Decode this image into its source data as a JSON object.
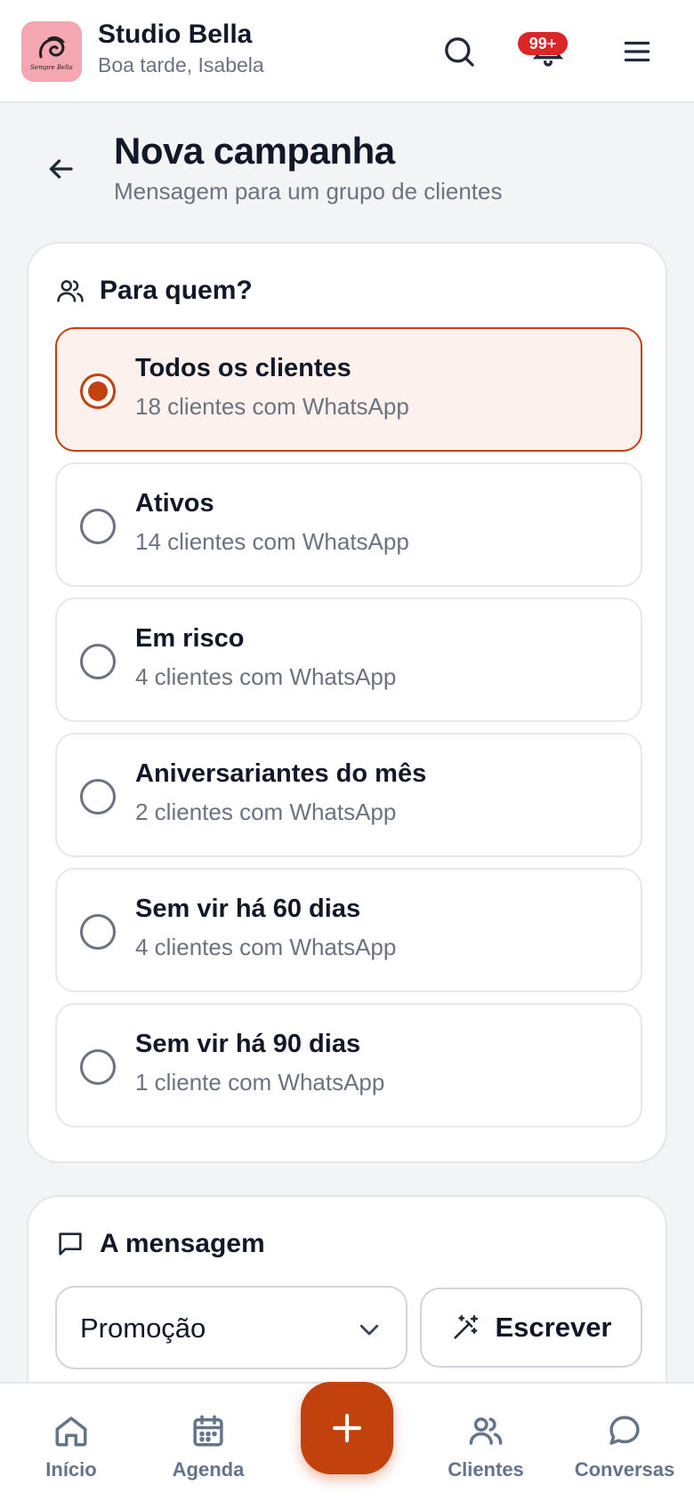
{
  "colors": {
    "accent": "#c2410c",
    "selected_bg": "#fcf1ed",
    "badge": "#dc2626",
    "muted_text": "#6b7280",
    "logo_bg": "#f4a7b0"
  },
  "header": {
    "brand_name": "Studio Bella",
    "greeting": "Boa tarde, Isabela",
    "logo_text": "Sempre Bella",
    "notification_badge": "99+",
    "icons": [
      "search-icon",
      "notifications-icon",
      "menu-icon"
    ]
  },
  "page": {
    "title": "Nova campanha",
    "subtitle": "Mensagem para um grupo de clientes"
  },
  "audience": {
    "title": "Para quem?",
    "options": [
      {
        "label": "Todos os clientes",
        "count": "18 clientes com WhatsApp",
        "selected": true
      },
      {
        "label": "Ativos",
        "count": "14 clientes com WhatsApp",
        "selected": false
      },
      {
        "label": "Em risco",
        "count": "4 clientes com WhatsApp",
        "selected": false
      },
      {
        "label": "Aniversariantes do mês",
        "count": "2 clientes com WhatsApp",
        "selected": false
      },
      {
        "label": "Sem vir há 60 dias",
        "count": "4 clientes com WhatsApp",
        "selected": false
      },
      {
        "label": "Sem vir há 90 dias",
        "count": "1 cliente com WhatsApp",
        "selected": false
      }
    ]
  },
  "message": {
    "title": "A mensagem",
    "type_select_value": "Promoção",
    "write_button": "Escrever"
  },
  "bottom_nav": {
    "items": [
      {
        "label": "Início",
        "icon": "home-icon"
      },
      {
        "label": "Agenda",
        "icon": "calendar-icon"
      },
      {
        "label": "Clientes",
        "icon": "users-icon"
      },
      {
        "label": "Conversas",
        "icon": "chat-icon"
      }
    ],
    "fab_icon": "plus-icon"
  }
}
